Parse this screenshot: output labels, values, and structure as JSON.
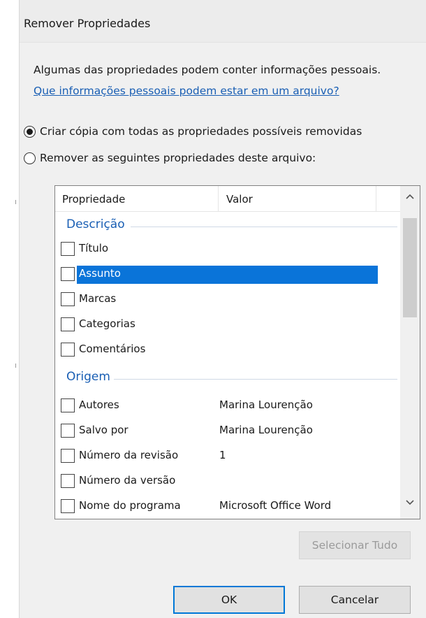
{
  "dialog": {
    "title": "Remover Propriedades",
    "info_text": "Algumas das propriedades podem conter informações pessoais.",
    "link_text": "Que informações pessoais podem estar em um arquivo?"
  },
  "options": [
    {
      "label": "Criar cópia com todas as propriedades possíveis removidas",
      "selected": true
    },
    {
      "label": "Remover as seguintes propriedades deste arquivo:",
      "selected": false
    }
  ],
  "table": {
    "columns": [
      "Propriedade",
      "Valor"
    ],
    "groups": [
      {
        "name": "Descrição",
        "rows": [
          {
            "label": "Título",
            "value": "",
            "checked": false,
            "selected": false
          },
          {
            "label": "Assunto",
            "value": "",
            "checked": false,
            "selected": true
          },
          {
            "label": "Marcas",
            "value": "",
            "checked": false,
            "selected": false
          },
          {
            "label": "Categorias",
            "value": "",
            "checked": false,
            "selected": false
          },
          {
            "label": "Comentários",
            "value": "",
            "checked": false,
            "selected": false
          }
        ]
      },
      {
        "name": "Origem",
        "rows": [
          {
            "label": "Autores",
            "value": "Marina Lourenção",
            "checked": false,
            "selected": false
          },
          {
            "label": "Salvo por",
            "value": "Marina Lourenção",
            "checked": false,
            "selected": false
          },
          {
            "label": "Número da revisão",
            "value": "1",
            "checked": false,
            "selected": false
          },
          {
            "label": "Número da versão",
            "value": "",
            "checked": false,
            "selected": false
          },
          {
            "label": "Nome do programa",
            "value": "Microsoft Office Word",
            "checked": false,
            "selected": false
          }
        ]
      }
    ]
  },
  "scrollbar": {
    "up_icon": "chevron-up-icon",
    "down_icon": "chevron-down-icon"
  },
  "buttons": {
    "select_all": "Selecionar Tudo",
    "ok": "OK",
    "cancel": "Cancelar"
  },
  "colors": {
    "link": "#1a5fb4",
    "group_header": "#1a5fb4",
    "selection": "#0a74d9",
    "default_button_border": "#0078d7"
  }
}
